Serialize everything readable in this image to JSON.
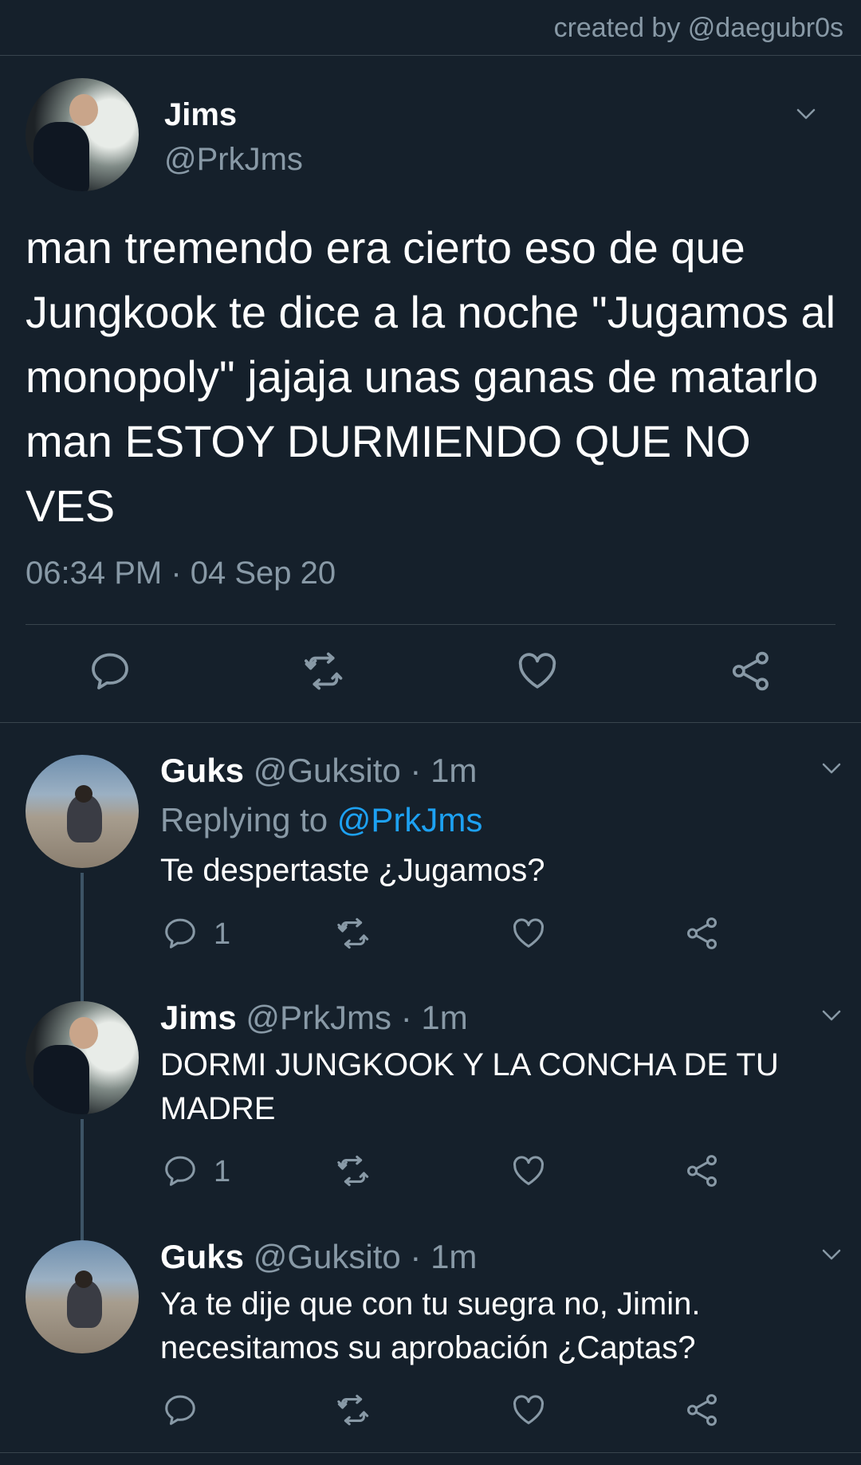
{
  "credit": "created by @daegubr0s",
  "main_tweet": {
    "name": "Jims",
    "handle": "@PrkJms",
    "text": "man tremendo era cierto eso de que Jungkook te dice a la noche \"Jugamos al monopoly\" jajaja unas ganas de matarlo man ESTOY DURMIENDO QUE NO VES",
    "timestamp": "06:34 PM · 04 Sep 20",
    "actions": [
      "reply-icon",
      "retweet-icon",
      "like-icon",
      "share-icon"
    ]
  },
  "replies": [
    {
      "name": "Guks",
      "meta": "@Guksito · 1m",
      "replying_prefix": "Replying to",
      "replying_to": "@PrkJms",
      "text": "Te despertaste ¿Jugamos?",
      "reply_count": "1"
    },
    {
      "name": "Jims",
      "meta": "@PrkJms · 1m",
      "text": "DORMI JUNGKOOK Y LA CONCHA DE TU MADRE",
      "reply_count": "1"
    },
    {
      "name": "Guks",
      "meta": "@Guksito · 1m",
      "text": "Ya te dije que con tu suegra no, Jimin. necesitamos su aprobación ¿Captas?",
      "reply_count": ""
    }
  ],
  "colors": {
    "background": "#15202b",
    "secondary_text": "#8899a6",
    "accent": "#1da1f2",
    "divider": "#38444d"
  }
}
